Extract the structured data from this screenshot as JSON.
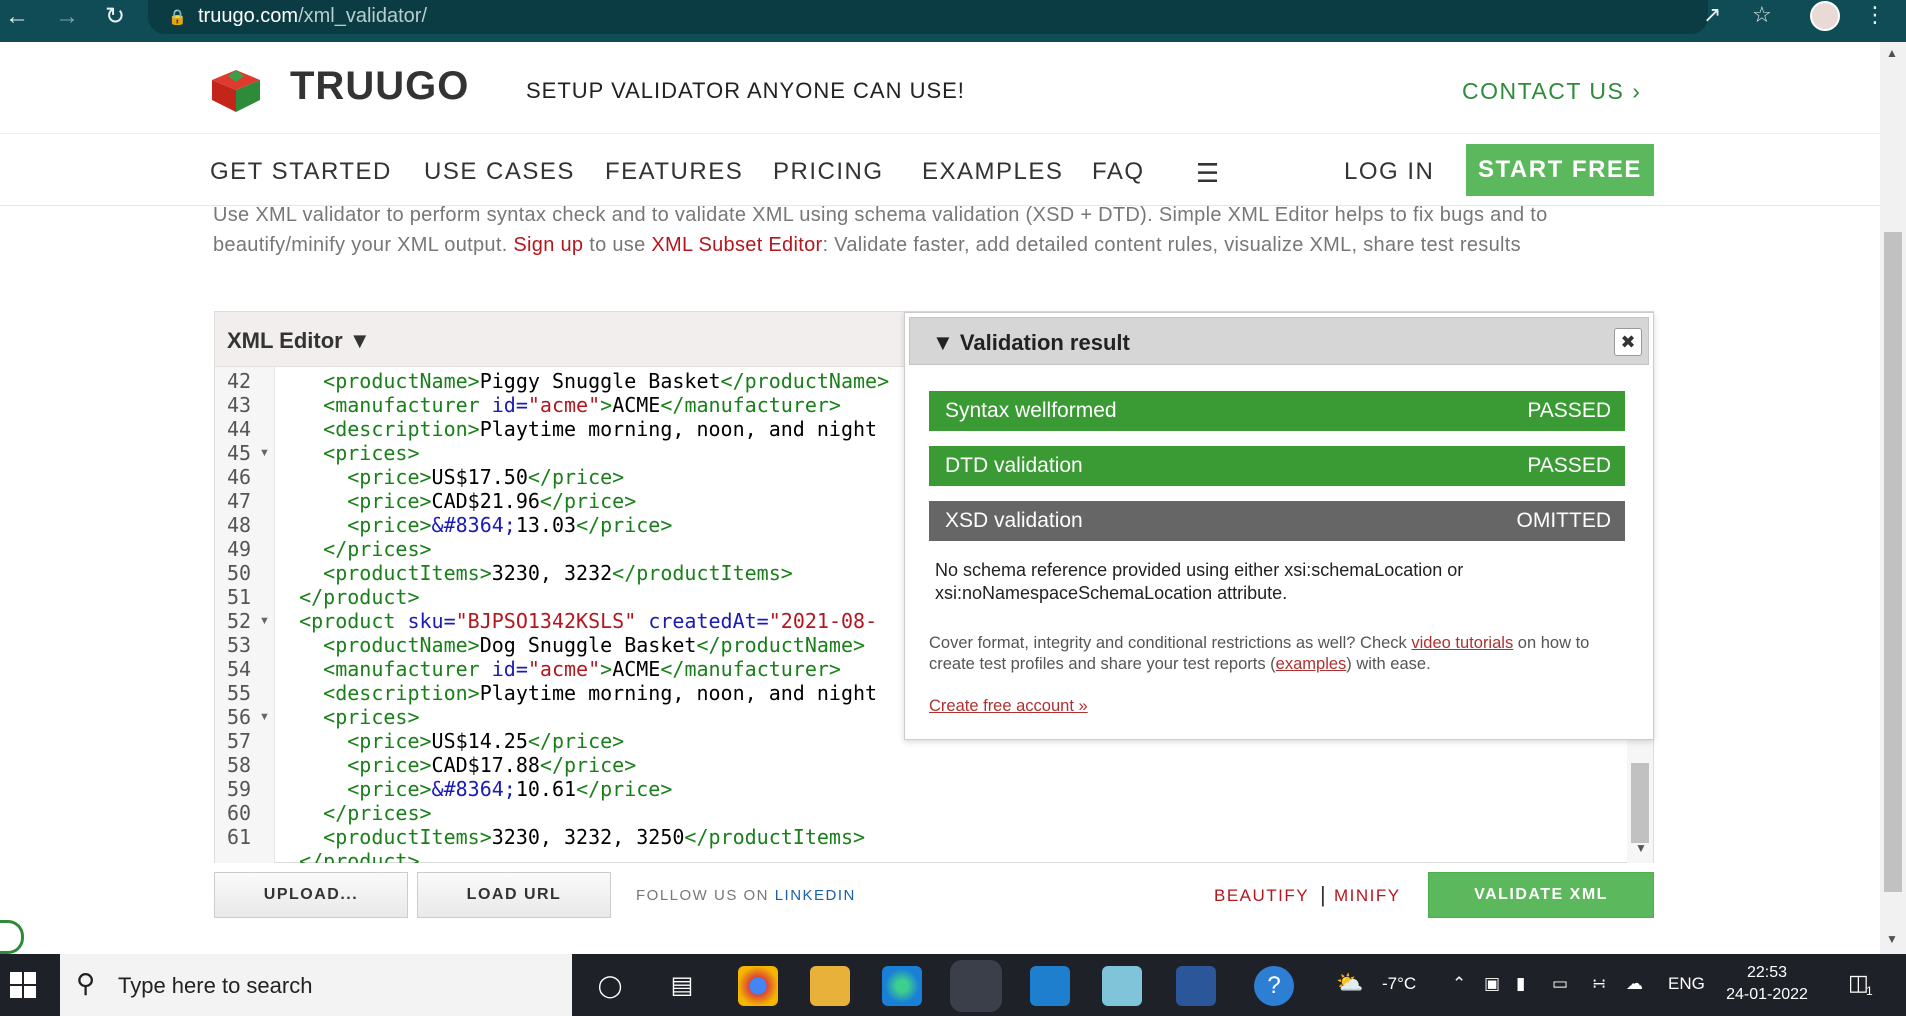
{
  "browser": {
    "url_domain": "truugo.com",
    "url_path": "/xml_validator/"
  },
  "header": {
    "logo_text": "TRUUGO",
    "tagline": "SETUP VALIDATOR ANYONE CAN USE!",
    "contact": "CONTACT US ›"
  },
  "nav": {
    "items": [
      "GET STARTED",
      "USE CASES",
      "FEATURES",
      "PRICING",
      "EXAMPLES",
      "FAQ"
    ],
    "login": "LOG IN",
    "start_free": "START FREE"
  },
  "intro": {
    "text1": "Use XML validator to perform syntax check and to validate XML using schema validation (XSD + DTD). Simple XML Editor helps to fix bugs and to beautify/minify your XML output. ",
    "signup": "Sign up",
    "text2": " to use ",
    "subset_editor": "XML Subset Editor",
    "text3": ": Validate faster, add detailed content rules, visualize XML, share test results"
  },
  "editor": {
    "title": "XML Editor ▼",
    "line_numbers": [
      "42",
      "43",
      "44",
      "45",
      "46",
      "47",
      "48",
      "49",
      "50",
      "51",
      "52",
      "53",
      "54",
      "55",
      "56",
      "57",
      "58",
      "59",
      "60",
      "61"
    ]
  },
  "validation": {
    "title": "Validation result",
    "rows": [
      {
        "label": "Syntax wellformed",
        "status": "PASSED"
      },
      {
        "label": "DTD validation",
        "status": "PASSED"
      },
      {
        "label": "XSD validation",
        "status": "OMITTED"
      }
    ],
    "note": "No schema reference provided using either xsi:schemaLocation or xsi:noNamespaceSchemaLocation attribute.",
    "cover_text1": "Cover format, integrity and conditional restrictions as well? Check ",
    "cover_link1": "video tutorials",
    "cover_text2": " on how to create test profiles and share your test reports (",
    "cover_link2": "examples",
    "cover_text3": ") with ease.",
    "create_account": "Create free account »"
  },
  "toolbar": {
    "upload": "UPLOAD...",
    "load_url": "LOAD URL",
    "follow": "FOLLOW US ON ",
    "linkedin": "LINKEDIN",
    "beautify": "BEAUTIFY",
    "separator": "|",
    "minify": "MINIFY",
    "validate": "VALIDATE XML"
  },
  "taskbar": {
    "search_placeholder": "Type here to search",
    "weather": "-7°C",
    "lang": "ENG",
    "time": "22:53",
    "date": "24-01-2022",
    "notification_count": "1"
  },
  "colors": {
    "brand_green": "#5cb85c",
    "pass_green": "#3a9b35",
    "link_red": "#b5161e",
    "chrome_teal": "#0f4c55"
  }
}
